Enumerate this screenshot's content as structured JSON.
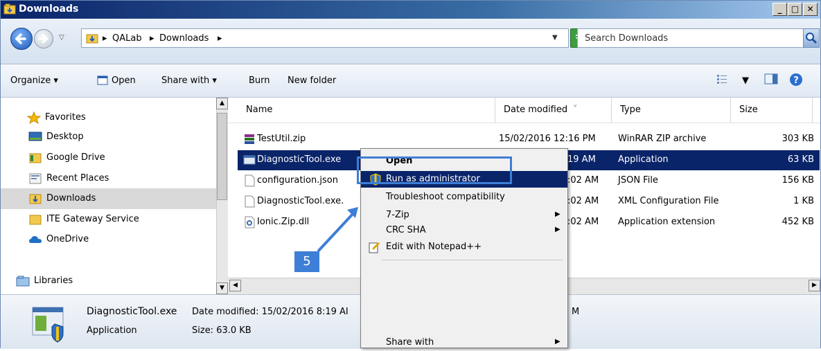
{
  "window": {
    "title": "Downloads"
  },
  "address": {
    "crumbs": [
      "QALab",
      "Downloads"
    ],
    "search_placeholder": "Search Downloads"
  },
  "toolbar": {
    "organize": "Organize",
    "open": "Open",
    "share_with": "Share with",
    "burn": "Burn",
    "new_folder": "New folder"
  },
  "nav": {
    "favorites": "Favorites",
    "items": [
      "Desktop",
      "Google Drive",
      "Recent Places",
      "Downloads",
      "ITE Gateway Service",
      "OneDrive"
    ],
    "libraries": "Libraries"
  },
  "columns": {
    "name": "Name",
    "date": "Date modified",
    "type": "Type",
    "size": "Size"
  },
  "files": [
    {
      "name": "TestUtil.zip",
      "date": "15/02/2016 12:16 PM",
      "type": "WinRAR ZIP archive",
      "size": "303 KB"
    },
    {
      "name": "DiagnosticTool.exe",
      "date": "19 AM",
      "type": "Application",
      "size": "63 KB"
    },
    {
      "name": "configuration.json",
      "date": ":02 AM",
      "type": "JSON File",
      "size": "156 KB"
    },
    {
      "name": "DiagnosticTool.exe.",
      "date": ":02 AM",
      "type": "XML Configuration File",
      "size": "1 KB"
    },
    {
      "name": "Ionic.Zip.dll",
      "date": ":02 AM",
      "type": "Application extension",
      "size": "452 KB"
    }
  ],
  "details": {
    "filename": "DiagnosticTool.exe",
    "date_label": "Date modified: 15/02/2016 8:19 AI",
    "date_tail": "M",
    "type": "Application",
    "size": "Size: 63.0 KB"
  },
  "context_menu": {
    "open": "Open",
    "run_as_admin": "Run as administrator",
    "troubleshoot": "Troubleshoot compatibility",
    "seven_zip": "7-Zip",
    "crc_sha": "CRC SHA",
    "edit_notepad": "Edit with Notepad++",
    "share_with": "Share with"
  },
  "annotation": {
    "step": "5"
  },
  "colors": {
    "selection": "#0a246a",
    "callout": "#3d7ed6"
  }
}
